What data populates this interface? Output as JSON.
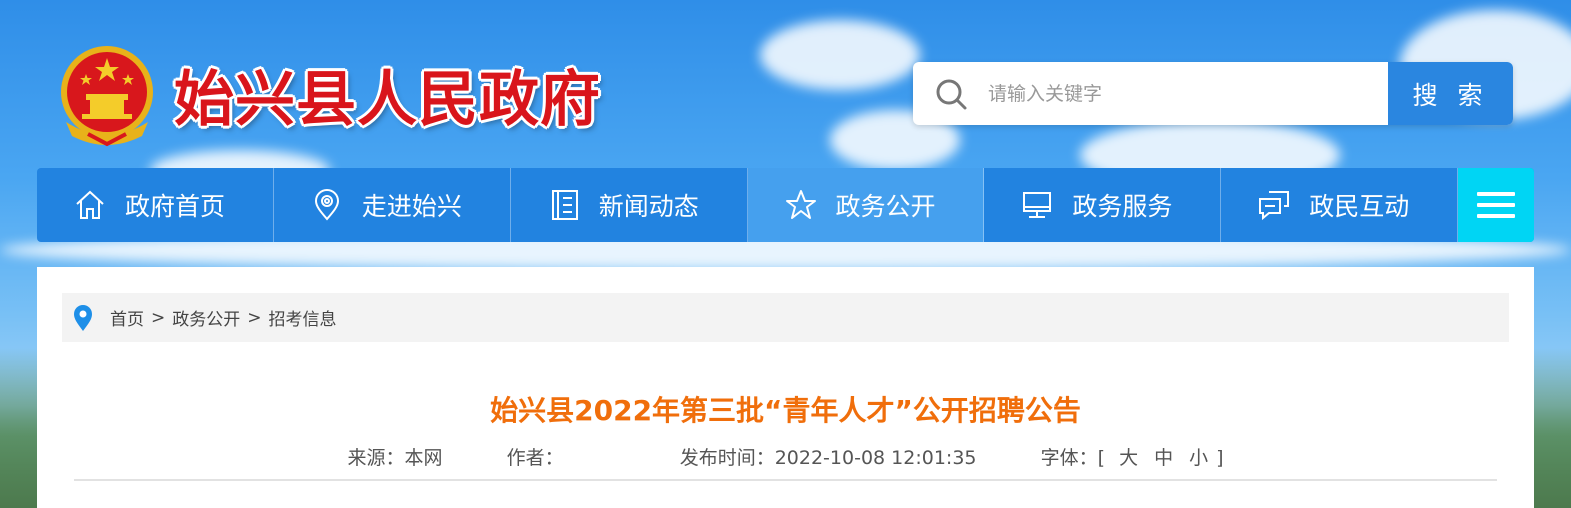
{
  "header": {
    "site_title": "始兴县人民政府",
    "emblem_icon": "national-emblem-icon"
  },
  "search": {
    "placeholder": "请输入关键字",
    "button_label": "搜 索"
  },
  "nav": {
    "items": [
      {
        "label": "政府首页",
        "icon": "home-icon"
      },
      {
        "label": "走进始兴",
        "icon": "location-pin-icon"
      },
      {
        "label": "新闻动态",
        "icon": "news-icon"
      },
      {
        "label": "政务公开",
        "icon": "star-icon",
        "active": true
      },
      {
        "label": "政务服务",
        "icon": "monitor-icon"
      },
      {
        "label": "政民互动",
        "icon": "chat-icon"
      }
    ],
    "menu_icon": "hamburger-menu-icon"
  },
  "breadcrumb": {
    "items": [
      "首页",
      "政务公开",
      "招考信息"
    ],
    "separator": ">"
  },
  "article": {
    "title": "始兴县2022年第三批“青年人才”公开招聘公告",
    "source_label": "来源：",
    "source_value": "本网",
    "author_label": "作者：",
    "author_value": "",
    "publish_label": "发布时间：",
    "publish_value": "2022-10-08 12:01:35",
    "font_label": "字体：",
    "font_open": "[",
    "font_large": "大",
    "font_medium": "中",
    "font_small": "小",
    "font_close": "]"
  },
  "colors": {
    "title_red": "#d9151b",
    "nav_blue": "#2283e0",
    "nav_active": "#45a0ee",
    "menu_cyan": "#00d5f4",
    "article_orange": "#f06e0b"
  }
}
